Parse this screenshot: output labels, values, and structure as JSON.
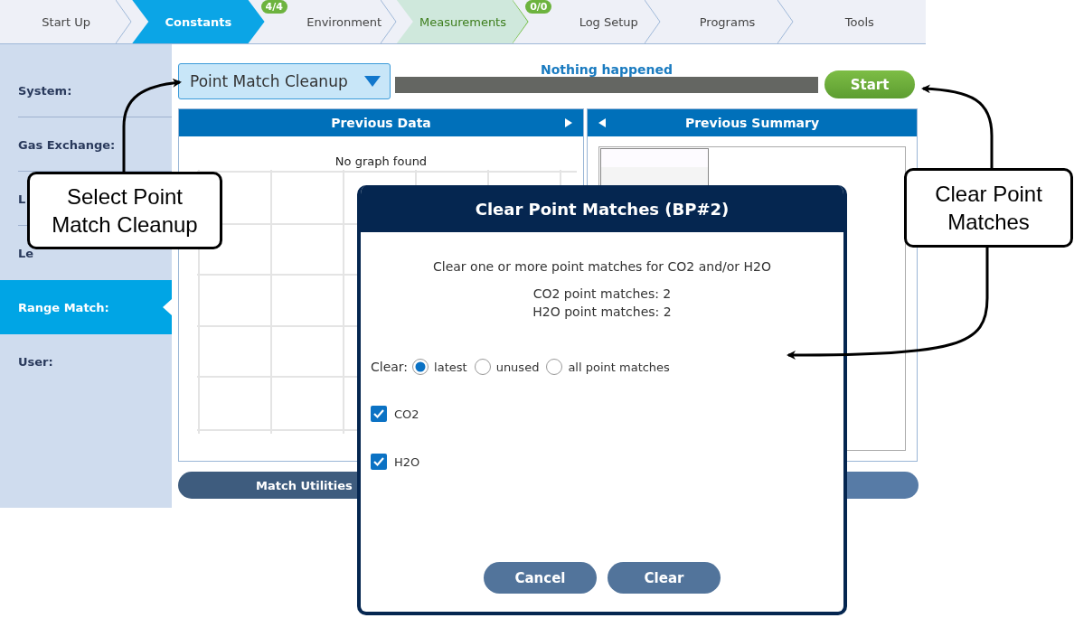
{
  "tabs": [
    {
      "label": "Start Up",
      "selected": false,
      "highlighted": false
    },
    {
      "label": "Constants",
      "selected": true,
      "highlighted": false
    },
    {
      "label": "Environment",
      "selected": false,
      "highlighted": false,
      "badge": "4/4"
    },
    {
      "label": "Measurements",
      "selected": false,
      "highlighted": true
    },
    {
      "label": "Log Setup",
      "selected": false,
      "highlighted": false,
      "badge": "0/0"
    },
    {
      "label": "Programs",
      "selected": false,
      "highlighted": false
    },
    {
      "label": "Tools",
      "selected": false,
      "highlighted": false
    }
  ],
  "sidebar": {
    "items": [
      {
        "label": "System:",
        "selected": false
      },
      {
        "label": "Gas Exchange:",
        "selected": false
      },
      {
        "label": "L",
        "selected": false
      },
      {
        "label": "Le",
        "selected": false
      },
      {
        "label": "Range Match:",
        "selected": true
      },
      {
        "label": "User:",
        "selected": false
      }
    ]
  },
  "toolbar": {
    "dropdown": "Point Match Cleanup",
    "status": "Nothing happened",
    "progress": {
      "level": 0
    },
    "start_button": "Start"
  },
  "panels": [
    {
      "title": "Previous Data",
      "message": "No graph found",
      "kind": "graph"
    },
    {
      "title": "Previous Summary",
      "kind": "summary"
    }
  ],
  "bottom_buttons": [
    "Match Utilities"
  ],
  "dialog": {
    "title": "Clear Point Matches (BP#2)",
    "description": "Clear one or more point matches for CO2 and/or H2O",
    "counts": [
      "CO2 point matches: 2",
      "H2O point matches: 2"
    ],
    "clear_label": "Clear:",
    "radios": [
      {
        "label": "latest",
        "selected": true
      },
      {
        "label": "unused",
        "selected": false
      },
      {
        "label": "all point matches",
        "selected": false
      }
    ],
    "checkboxes": [
      {
        "label": "CO2",
        "checked": true
      },
      {
        "label": "H2O",
        "checked": true
      }
    ],
    "buttons": [
      "Cancel",
      "Clear"
    ]
  },
  "callouts": [
    {
      "text": "Select Point Match Cleanup"
    },
    {
      "text": "Clear Point Matches"
    }
  ]
}
